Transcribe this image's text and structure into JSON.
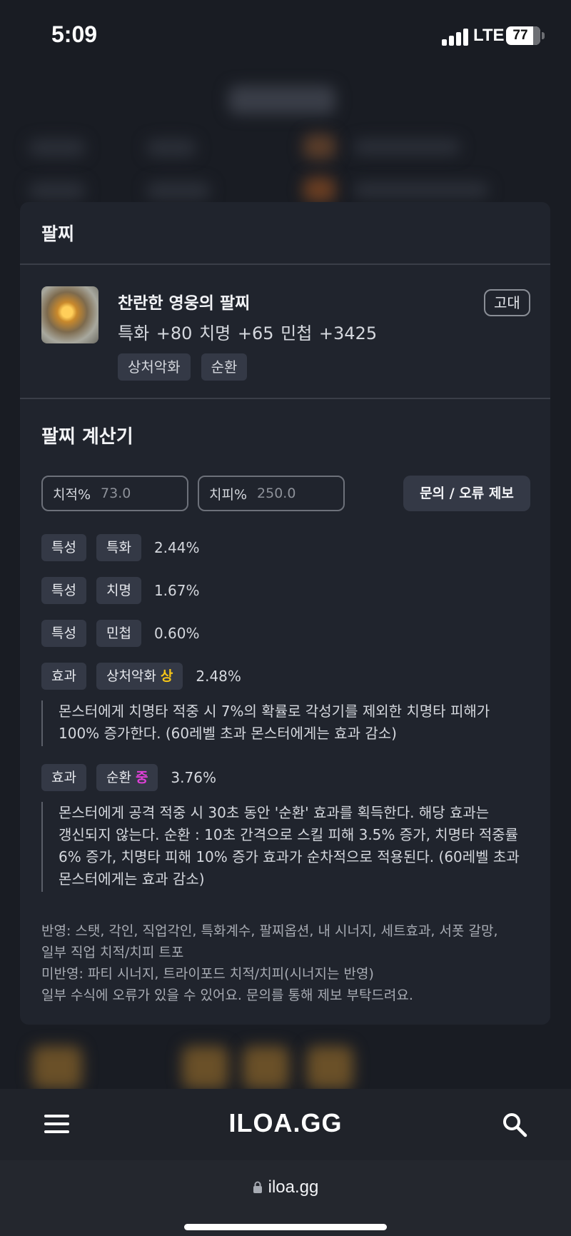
{
  "status_bar": {
    "time": "5:09",
    "network": "LTE",
    "battery": "77"
  },
  "modal": {
    "title": "팔찌",
    "item": {
      "name": "찬란한 영웅의 팔찌",
      "stats": "특화 +80  치명 +65  민첩 +3425",
      "tags": [
        "상처악화",
        "순환"
      ],
      "grade": "고대"
    },
    "calculator": {
      "title": "팔찌 계산기",
      "crit_rate": {
        "label": "치적%",
        "value": "73.0"
      },
      "crit_dmg": {
        "label": "치피%",
        "value": "250.0"
      },
      "report_button": "문의 / 오류 제보",
      "rows": [
        {
          "type": "특성",
          "name": "특화",
          "value": "2.44%"
        },
        {
          "type": "특성",
          "name": "치명",
          "value": "1.67%"
        },
        {
          "type": "특성",
          "name": "민첩",
          "value": "0.60%"
        }
      ],
      "effects": [
        {
          "type": "효과",
          "name": "상처악화",
          "level": "상",
          "value": "2.48%",
          "desc_lines": [
            "몬스터에게 치명타 적중 시 7%의 확률로 각성기를 제외한 치명타 피해가",
            "100% 증가한다. (60레벨 초과 몬스터에게는 효과 감소)"
          ]
        },
        {
          "type": "효과",
          "name": "순환",
          "level": "중",
          "value": "3.76%",
          "desc_lines": [
            "몬스터에게 공격 적중 시 30초 동안 '순환' 효과를 획득한다. 해당 효과는",
            "갱신되지 않는다. 순환 : 10초 간격으로 스킬 피해 3.5% 증가, 치명타 적중률",
            "6% 증가, 치명타 피해 10% 증가 효과가 순차적으로 적용된다. (60레벨 초과",
            "몬스터에게는 효과 감소)"
          ]
        }
      ],
      "notes": [
        "반영: 스탯, 각인, 직업각인, 특화계수, 팔찌옵션, 내 시너지, 세트효과, 서폿 갈망,",
        "일부 직업 치적/치피 트포",
        "미반영: 파티 시너지, 트라이포드 치적/치피(시너지는 반영)",
        "일부 수식에 오류가 있을 수 있어요. 문의를 통해 제보 부탁드려요."
      ]
    }
  },
  "bottom_nav": {
    "logo": "ILOA.GG",
    "menu_icon": "hamburger-icon",
    "search_icon": "search-icon"
  },
  "url_bar": {
    "url": "iloa.gg",
    "icon": "lock-icon"
  },
  "colors": {
    "level_high": "#f5c518",
    "level_mid": "#e040d8",
    "surface": "#20242d",
    "chip": "#343946"
  }
}
